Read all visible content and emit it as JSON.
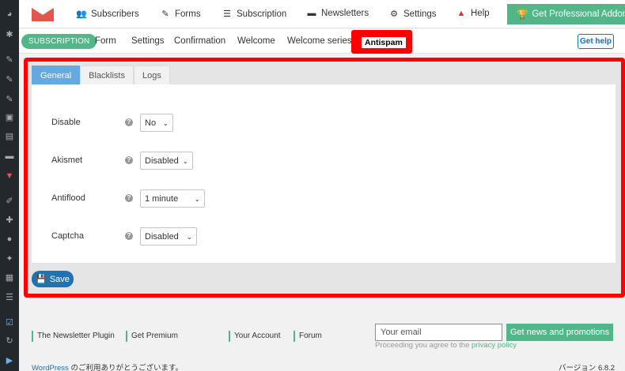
{
  "colors": {
    "accent_green": "#52b788",
    "highlight_red": "#ff0000",
    "active_tab_blue": "#66a9e0",
    "save_blue": "#2271b1"
  },
  "sidebar": {
    "icons": [
      "dashboard-icon",
      "gear-icon",
      "pin-icon",
      "pin-icon",
      "pin-icon",
      "media-icon",
      "pages-icon",
      "comments-icon",
      "newsletter-icon",
      "brush-icon",
      "plugin-icon",
      "users-icon",
      "tools-icon",
      "grid-icon",
      "list-icon",
      "checkbox-icon",
      "refresh-icon",
      "play-icon"
    ]
  },
  "topnav": {
    "items": [
      {
        "label": "Subscribers",
        "icon": "users-icon"
      },
      {
        "label": "Forms",
        "icon": "edit-icon"
      },
      {
        "label": "Subscription",
        "icon": "list-icon"
      },
      {
        "label": "Newsletters",
        "icon": "newspaper-icon"
      },
      {
        "label": "Settings",
        "icon": "gear-icon"
      },
      {
        "label": "Help",
        "icon": "warning-icon"
      }
    ],
    "pro_button": "Get Professional Addons"
  },
  "subnav": {
    "badge": "SUBSCRIPTION",
    "links": [
      "Form",
      "Settings",
      "Confirmation",
      "Welcome",
      "Welcome series"
    ],
    "active": "Antispam",
    "help_button": "Get help"
  },
  "tabs": [
    {
      "label": "General",
      "active": true
    },
    {
      "label": "Blacklists",
      "active": false
    },
    {
      "label": "Logs",
      "active": false
    }
  ],
  "fields": [
    {
      "label": "Disable",
      "value": "No"
    },
    {
      "label": "Akismet",
      "value": "Disabled"
    },
    {
      "label": "Antiflood",
      "value": "1 minute"
    },
    {
      "label": "Captcha",
      "value": "Disabled"
    }
  ],
  "save_label": "Save",
  "footer": {
    "links": [
      "The Newsletter Plugin",
      "Get Premium",
      "Your Account",
      "Forum"
    ],
    "email_placeholder": "Your email",
    "news_button": "Get news and promotions",
    "privacy_prefix": "Proceeding you agree to the",
    "privacy_link": "privacy policy",
    "wp_link": "WordPress",
    "wp_thanks": " のご利用ありがとうございます。",
    "version": "バージョン 6.8.2"
  }
}
